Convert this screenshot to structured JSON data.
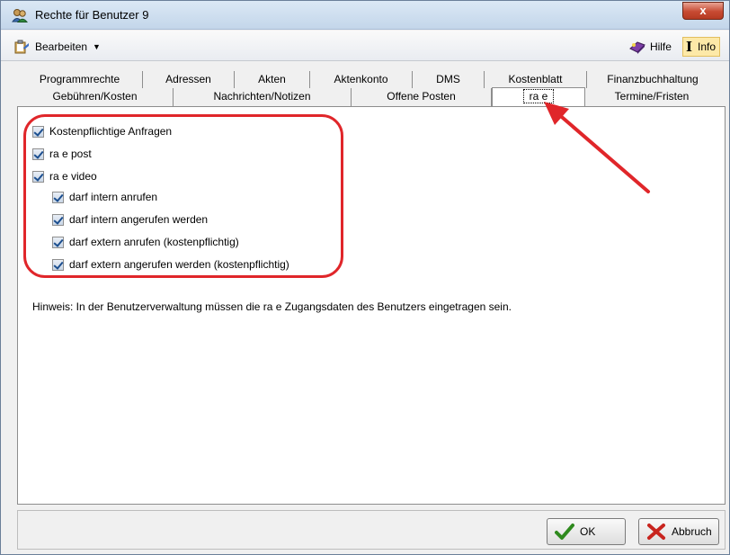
{
  "window": {
    "title": "Rechte für Benutzer 9",
    "close_label": "x"
  },
  "menu": {
    "edit_label": "Bearbeiten",
    "help_label": "Hilfe",
    "info_label": "Info"
  },
  "tabs": {
    "row1": [
      "Programmrechte",
      "Adressen",
      "Akten",
      "Aktenkonto",
      "DMS",
      "Kostenblatt",
      "Finanzbuchhaltung"
    ],
    "row2": [
      "Gebühren/Kosten",
      "Nachrichten/Notizen",
      "Offene Posten",
      "ra e",
      "Termine/Fristen"
    ],
    "active": "ra e"
  },
  "options": [
    {
      "label": "Kostenpflichtige Anfragen",
      "checked": true
    },
    {
      "label": "ra e post",
      "checked": true
    },
    {
      "label": "ra e video",
      "checked": true
    },
    {
      "label": "darf intern anrufen",
      "checked": true
    },
    {
      "label": "darf intern angerufen werden",
      "checked": true
    },
    {
      "label": "darf extern anrufen (kostenpflichtig)",
      "checked": true
    },
    {
      "label": "darf extern angerufen werden (kostenpflichtig)",
      "checked": true
    }
  ],
  "hint": "Hinweis: In der Benutzerverwaltung müssen die ra e Zugangsdaten des Benutzers eingetragen sein.",
  "buttons": {
    "ok": "OK",
    "cancel": "Abbruch"
  },
  "colors": {
    "highlight": "#e0262a",
    "arrow": "#e0262a"
  },
  "icons": {
    "title": "users-icon",
    "edit": "clipboard-icon",
    "help": "help-book-icon",
    "info": "info-icon",
    "ok": "checkmark-icon",
    "cancel": "cross-icon"
  }
}
